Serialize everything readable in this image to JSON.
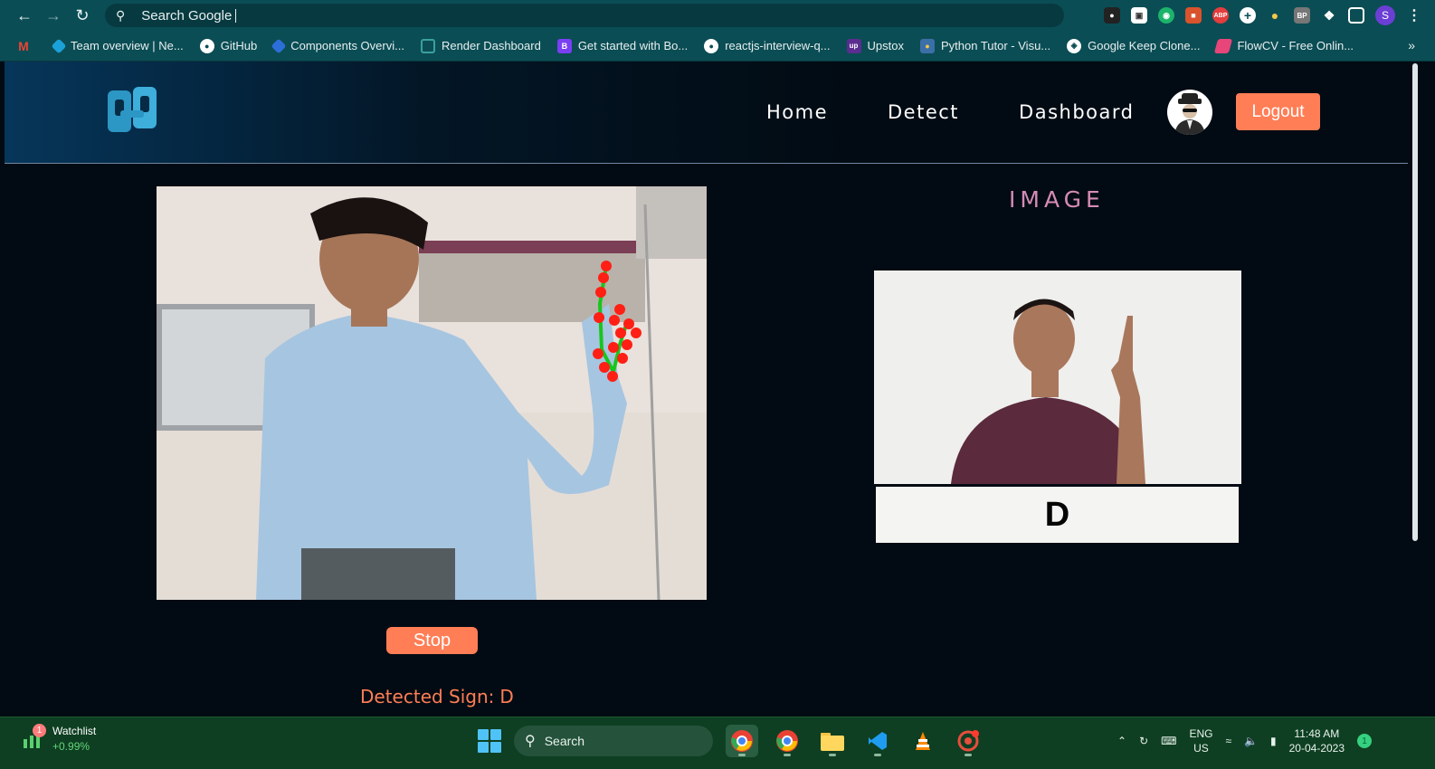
{
  "browser": {
    "omnibox_text": "Search Google",
    "profile_initial": "S",
    "bookmarks": [
      {
        "label": "Team overview | Ne...",
        "color": "#1ba0d8"
      },
      {
        "label": "GitHub",
        "color": "#ffffff"
      },
      {
        "label": "Components Overvi...",
        "color": "#2d6fd8"
      },
      {
        "label": "Render Dashboard",
        "color": "#3aa0a0"
      },
      {
        "label": "Get started with Bo...",
        "color": "#7a3ff2"
      },
      {
        "label": "reactjs-interview-q...",
        "color": "#ffffff"
      },
      {
        "label": "Upstox",
        "color": "#5b2d90"
      },
      {
        "label": "Python Tutor - Visu...",
        "color": "#f2c84b"
      },
      {
        "label": "Google Keep Clone...",
        "color": "#ffffff"
      },
      {
        "label": "FlowCV - Free Onlin...",
        "color": "#e8457a"
      }
    ],
    "more_bookmarks": "»"
  },
  "site": {
    "nav": [
      "Home",
      "Detect",
      "Dashboard"
    ],
    "logout_label": "Logout",
    "accent": "#ff7e56",
    "image_title": "IMAGE",
    "sign_letter": "D",
    "stop_label": "Stop",
    "detected_label": "Detected Sign:",
    "detected_value": "D"
  },
  "taskbar": {
    "watchlist_label": "Watchlist",
    "watchlist_badge": "1",
    "watchlist_change": "+0.99%",
    "search_label": "Search",
    "lang_top": "ENG",
    "lang_bottom": "US",
    "time": "11:48 AM",
    "date": "20-04-2023",
    "notification_count": "1"
  }
}
